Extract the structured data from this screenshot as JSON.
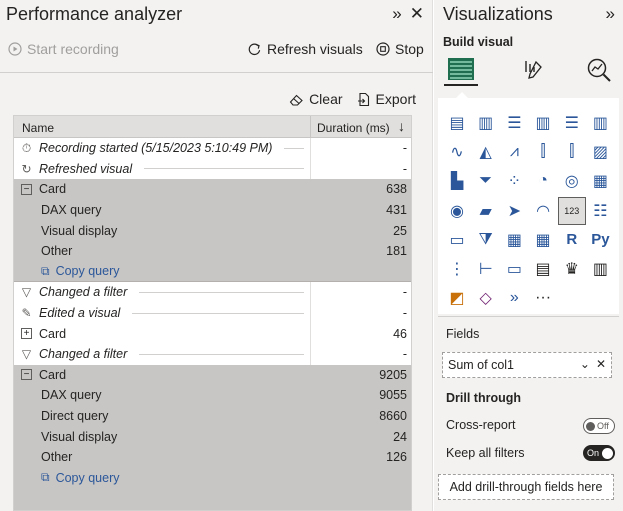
{
  "perf": {
    "title": "Performance analyzer",
    "start_recording": "Start recording",
    "refresh_visuals": "Refresh visuals",
    "stop": "Stop",
    "clear": "Clear",
    "export": "Export",
    "col_name": "Name",
    "col_duration": "Duration (ms)",
    "rows": [
      {
        "kind": "ev",
        "icon": "timer-icon",
        "glyph": "⏱",
        "name": "Recording started (5/15/2023 5:10:49 PM)",
        "dur": "-"
      },
      {
        "kind": "ev",
        "icon": "refresh-icon",
        "glyph": "↻",
        "name": "Refreshed visual",
        "dur": "-"
      },
      {
        "kind": "grp",
        "icon": "collapse-icon",
        "glyph": "−",
        "name": "Card",
        "dur": "638"
      },
      {
        "kind": "sub",
        "name": "DAX query",
        "dur": "431"
      },
      {
        "kind": "sub",
        "name": "Visual display",
        "dur": "25"
      },
      {
        "kind": "sub",
        "name": "Other",
        "dur": "181"
      },
      {
        "kind": "link",
        "name": "Copy query",
        "dur": ""
      },
      {
        "kind": "ev",
        "icon": "filter-icon",
        "glyph": "▽",
        "name": "Changed a filter",
        "dur": "-"
      },
      {
        "kind": "ev",
        "icon": "pencil-icon",
        "glyph": "✎",
        "name": "Edited a visual",
        "dur": "-"
      },
      {
        "kind": "item",
        "icon": "expand-icon",
        "glyph": "+",
        "name": "Card",
        "dur": "46"
      },
      {
        "kind": "ev",
        "icon": "filter-icon",
        "glyph": "▽",
        "name": "Changed a filter",
        "dur": "-"
      },
      {
        "kind": "grp",
        "icon": "collapse-icon",
        "glyph": "−",
        "name": "Card",
        "dur": "9205"
      },
      {
        "kind": "sub",
        "name": "DAX query",
        "dur": "9055"
      },
      {
        "kind": "sub",
        "name": "Direct query",
        "dur": "8660"
      },
      {
        "kind": "sub",
        "name": "Visual display",
        "dur": "24"
      },
      {
        "kind": "sub",
        "name": "Other",
        "dur": "126"
      },
      {
        "kind": "link",
        "name": "Copy query",
        "dur": ""
      }
    ]
  },
  "viz": {
    "title": "Visualizations",
    "build_visual": "Build visual",
    "fields_label": "Fields",
    "field_value": "Sum of col1",
    "drill_through": "Drill through",
    "cross_report": "Cross-report",
    "cross_report_state": "Off",
    "keep_all_filters": "Keep all filters",
    "keep_all_filters_state": "On",
    "drill_placeholder": "Add drill-through fields here",
    "icons": [
      "stacked-bar-icon",
      "stacked-column-icon",
      "clustered-bar-icon",
      "clustered-column-icon",
      "100-stacked-bar-icon",
      "100-stacked-column-icon",
      "line-chart-icon",
      "area-chart-icon",
      "stacked-area-icon",
      "line-stacked-column-icon",
      "line-clustered-column-icon",
      "ribbon-chart-icon",
      "waterfall-icon",
      "funnel-icon",
      "scatter-icon",
      "pie-chart-icon",
      "donut-chart-icon",
      "treemap-icon",
      "map-icon",
      "filled-map-icon",
      "azure-map-icon",
      "gauge-icon",
      "card-icon",
      "multi-row-card-icon",
      "kpi-icon",
      "slicer-icon",
      "table-icon",
      "matrix-icon",
      "r-visual-icon",
      "python-visual-icon",
      "key-influencers-icon",
      "decomposition-tree-icon",
      "qa-icon",
      "smart-narrative-icon",
      "goals-icon",
      "paginated-report-icon",
      "arcgis-icon",
      "power-apps-icon",
      "power-automate-icon",
      "more-visuals-icon"
    ]
  }
}
